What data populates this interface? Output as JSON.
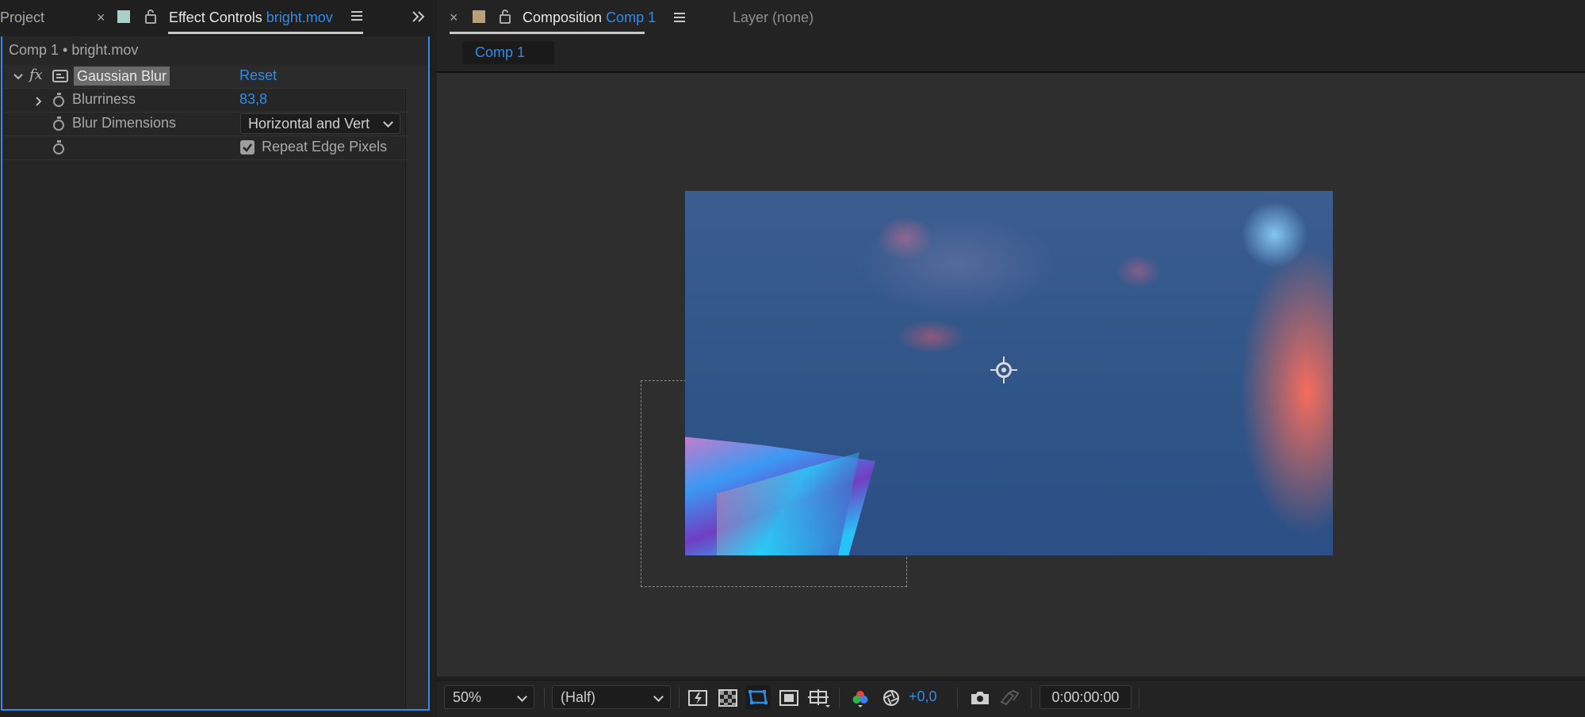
{
  "left_tabs": {
    "project_tab": "Project",
    "effect_controls_label": "Effect Controls",
    "effect_controls_file": "bright.mov"
  },
  "effect_controls": {
    "breadcrumb": "Comp 1 • bright.mov",
    "effect_name": "Gaussian Blur",
    "reset_label": "Reset",
    "params": {
      "blurriness_label": "Blurriness",
      "blurriness_value": "83,8",
      "blur_dimensions_label": "Blur Dimensions",
      "blur_dimensions_value": "Horizontal and Vert",
      "repeat_edge_label": "Repeat Edge Pixels",
      "repeat_edge_checked": true
    },
    "fx_glyph": "fx"
  },
  "composition": {
    "tab_label": "Composition",
    "comp_name": "Comp 1",
    "layer_tab": "Layer (none)",
    "sub_tab": "Comp 1"
  },
  "bottom_bar": {
    "zoom": "50%",
    "resolution": "(Half)",
    "exposure": "+0,0",
    "timecode": "0:00:00:00"
  },
  "colors": {
    "accent": "#2d8ceb",
    "panel": "#262626",
    "viewer": "#2e2e2e",
    "effect_swatch": "#a9d0c8",
    "comp_swatch": "#b9a07a"
  }
}
